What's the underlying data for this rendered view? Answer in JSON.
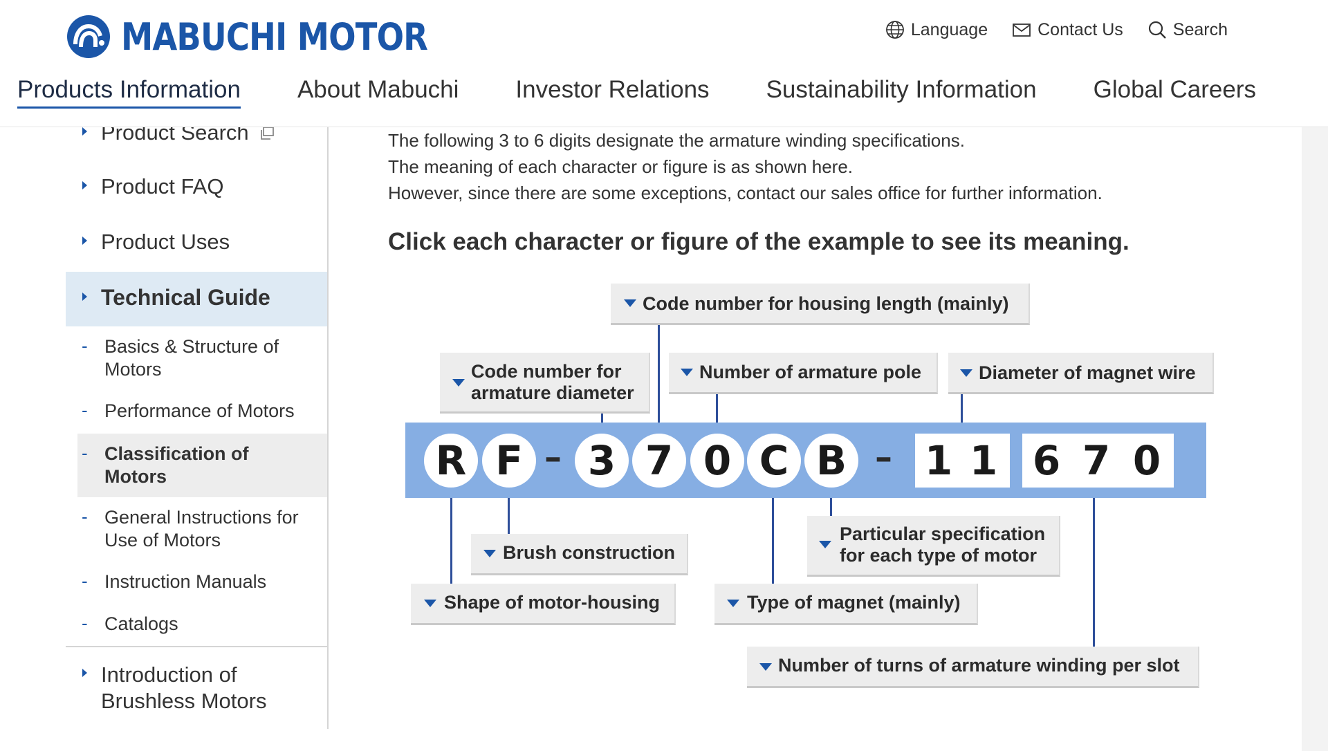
{
  "header": {
    "logo_text": "MABUCHI MOTOR",
    "utility": {
      "language": "Language",
      "contact": "Contact Us",
      "search": "Search"
    },
    "nav": [
      {
        "label": "Products Information",
        "active": true
      },
      {
        "label": "About Mabuchi"
      },
      {
        "label": "Investor Relations"
      },
      {
        "label": "Sustainability Information"
      },
      {
        "label": "Global Careers"
      }
    ]
  },
  "sidebar": {
    "items": [
      {
        "label": "Product Search"
      },
      {
        "label": "Product FAQ"
      },
      {
        "label": "Product Uses"
      },
      {
        "label": "Technical Guide",
        "active": true
      }
    ],
    "sub_items": [
      {
        "line1": "Basics & Structure of",
        "line2": "Motors"
      },
      {
        "line1": "Performance of Motors",
        "line2": ""
      },
      {
        "line1": "Classification of",
        "line2": "Motors",
        "active": true
      },
      {
        "line1": "General Instructions for",
        "line2": "Use of Motors"
      },
      {
        "line1": "Instruction Manuals",
        "line2": ""
      },
      {
        "line1": "Catalogs",
        "line2": ""
      }
    ],
    "bottom_item": {
      "line1": "Introduction of",
      "line2": "Brushless Motors"
    }
  },
  "main": {
    "lines": [
      "The following 3 to 6 digits designate the armature winding specifications.",
      "The meaning of each character or figure is as shown here.",
      "However, since there are some exceptions, contact our sales office for further information."
    ],
    "headline": "Click each character or figure of the example to see its meaning."
  },
  "diagram": {
    "characters": [
      "R",
      "F",
      "–",
      "3",
      "7",
      "0",
      "C",
      "B",
      "–",
      "1",
      "1",
      "6",
      "7",
      "0"
    ],
    "labels": {
      "housing_length": "Code number for housing length (mainly)",
      "armature_diameter_1": "Code number for",
      "armature_diameter_2": "armature diameter",
      "armature_pole": "Number of armature pole",
      "magnet_wire": "Diameter of magnet wire",
      "brush": "Brush construction",
      "particular_1": "Particular specification",
      "particular_2": "for each type of motor",
      "housing_shape": "Shape of motor-housing",
      "magnet_type": "Type of magnet (mainly)",
      "turns": "Number of turns of armature winding per slot"
    },
    "colors": {
      "bar": "#86aee3",
      "connector": "#2e4f9a",
      "arrow": "#1b56a8",
      "label_bg": "#ededed"
    }
  }
}
